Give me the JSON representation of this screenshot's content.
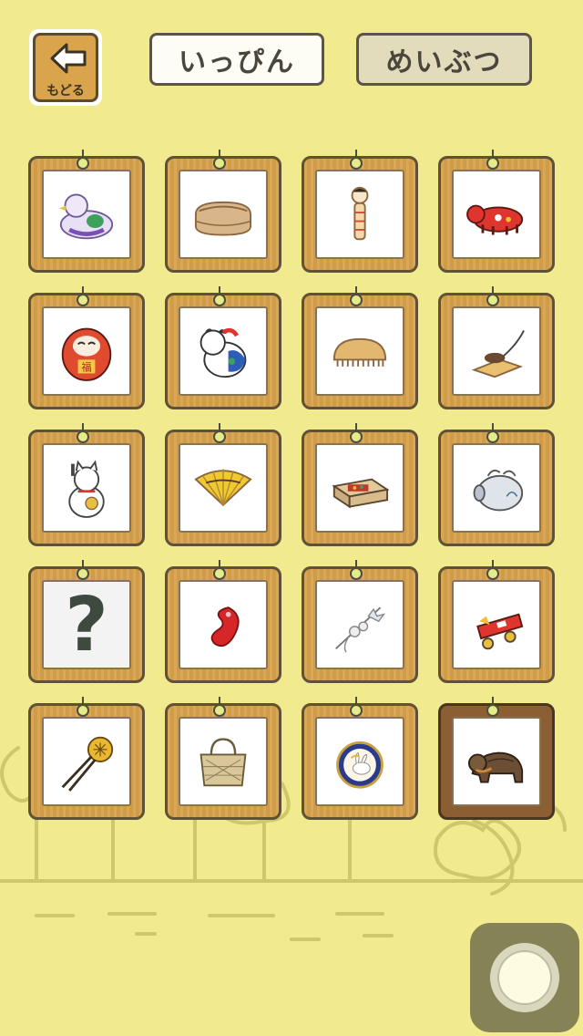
{
  "header": {
    "back_label": "もどる",
    "tab_ippin": "いっぴん",
    "tab_meibutsu": "めいぶつ"
  },
  "colors": {
    "background": "#f2ea8e",
    "card_wood": "#d7a24c",
    "card_wood_selected": "#8b5e34",
    "tab_active": "#fdfdf6",
    "tab_inactive": "#e3dcbc"
  },
  "items": [
    {
      "icon": "pigeon-whistle-icon"
    },
    {
      "icon": "bento-box-icon"
    },
    {
      "icon": "kokeshi-doll-icon"
    },
    {
      "icon": "red-cow-akabeko-icon"
    },
    {
      "icon": "daruma-icon"
    },
    {
      "icon": "inu-hariko-dog-icon"
    },
    {
      "icon": "wooden-comb-icon"
    },
    {
      "icon": "mousetrap-icon"
    },
    {
      "icon": "maneki-neko-icon"
    },
    {
      "icon": "folding-fan-icon"
    },
    {
      "icon": "matchbox-icon"
    },
    {
      "icon": "boar-incense-holder-icon"
    },
    {
      "icon": "unknown-question-icon",
      "text": "?"
    },
    {
      "icon": "magatama-bean-icon"
    },
    {
      "icon": "hairpin-kanzashi-icon"
    },
    {
      "icon": "tengu-mask-cart-icon"
    },
    {
      "icon": "ornamental-hairpin-icon"
    },
    {
      "icon": "woven-bag-icon"
    },
    {
      "icon": "rabbit-plate-icon"
    },
    {
      "icon": "bear-carving-icon"
    }
  ]
}
